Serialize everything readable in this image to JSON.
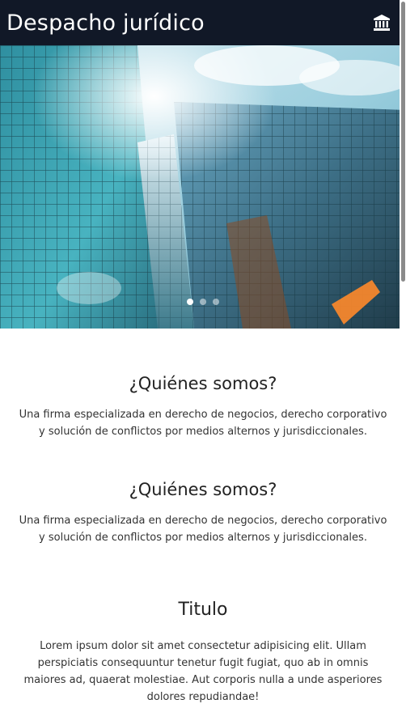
{
  "header": {
    "title": "Despacho jurídico",
    "icon": "bank-icon"
  },
  "hero": {
    "image": "glass-skyscraper-photo",
    "slides": 3,
    "active_slide": 0
  },
  "sections": [
    {
      "title": "¿Quiénes somos?",
      "text": "Una firma especializada en derecho de negocios, derecho corporativo y solución de conflictos por medios alternos y jurisdiccionales."
    },
    {
      "title": "¿Quiénes somos?",
      "text": "Una firma especializada en derecho de negocios, derecho corporativo y solución de conflictos por medios alternos y jurisdiccionales."
    },
    {
      "title": "Titulo",
      "text": "Lorem ipsum dolor sit amet consectetur adipisicing elit. Ullam perspiciatis consequuntur tenetur fugit fugiat, quo ab in omnis maiores ad, quaerat molestiae. Aut corporis nulla a unde asperiores dolores repudiandae!"
    }
  ],
  "colors": {
    "header_bg": "#111827",
    "header_text": "#ffffff",
    "body_text": "#222222"
  }
}
